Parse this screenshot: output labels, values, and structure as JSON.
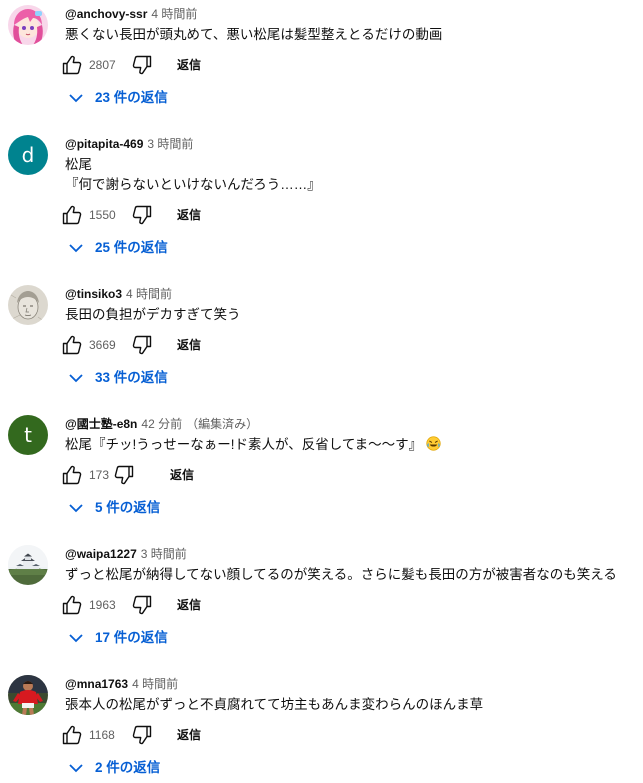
{
  "reply_label": "返信",
  "comments": [
    {
      "author": "@anchovy-ssr",
      "time": "4 時間前",
      "lines": [
        "悪くない長田が頭丸めて、悪い松尾は髪型整えとるだけの動画"
      ],
      "likes": "2807",
      "replies": "23 件の返信",
      "avatar": {
        "type": "image",
        "desc": "pink-haired anime character"
      }
    },
    {
      "author": "@pitapita-469",
      "time": "3 時間前",
      "lines": [
        "松尾",
        "『何で謝らないといけないんだろう……』"
      ],
      "likes": "1550",
      "replies": "25 件の返信",
      "avatar": {
        "type": "letter",
        "letter": "d",
        "color": "#00838f"
      }
    },
    {
      "author": "@tinsiko3",
      "time": "4 時間前",
      "lines": [
        "長田の負担がデカすぎて笑う"
      ],
      "likes": "3669",
      "replies": "33 件の返信",
      "avatar": {
        "type": "image",
        "desc": "pencil sketch portrait"
      }
    },
    {
      "author": "@國士塾-e8n",
      "time": "42 分前",
      "edited": "（編集済み）",
      "lines": [
        "松尾『チッ!うっせーなぁー!ド素人が、反省してま〜〜す』"
      ],
      "emoji": "rolling-on-floor-laughing-emoji",
      "likes": "173",
      "replies": "5 件の返信",
      "avatar": {
        "type": "letter",
        "letter": "t",
        "color": "#33691e"
      }
    },
    {
      "author": "@waipa1227",
      "time": "3 時間前",
      "lines": [
        "ずっと松尾が納得してない顔してるのが笑える。さらに髪も長田の方が被害者なのも笑える"
      ],
      "likes": "1963",
      "replies": "17 件の返信",
      "avatar": {
        "type": "image",
        "desc": "castle landscape"
      }
    },
    {
      "author": "@mna1763",
      "time": "4 時間前",
      "lines": [
        "張本人の松尾がずっと不貞腐れてて坊主もあんま変わらんのほんま草"
      ],
      "likes": "1168",
      "replies": "2 件の返信",
      "avatar": {
        "type": "image",
        "desc": "soccer player in red kit"
      }
    }
  ]
}
